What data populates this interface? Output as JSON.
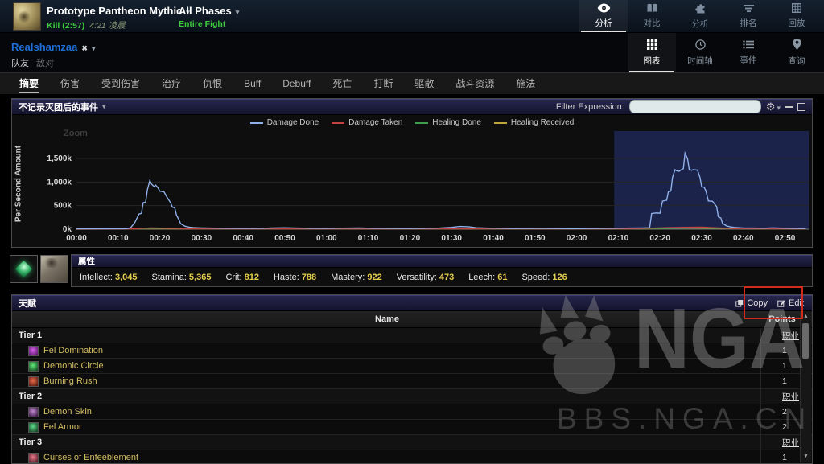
{
  "glyphs": {
    "caret": "▾",
    "close": "✖",
    "gear": "⚙",
    "scroll_up": "▲",
    "scroll_down": "▼"
  },
  "top_bar": {
    "boss_name": "Prototype Pantheon Mythic",
    "kill_text": "Kill (2:57)",
    "kill_time": "4:21 凌晨",
    "phase_name": "All Phases",
    "phase_detail": "Entire Fight",
    "view_tabs": [
      {
        "label": "分析",
        "icon": "eye-icon",
        "active": true
      },
      {
        "label": "对比",
        "icon": "compare-icon",
        "active": false
      },
      {
        "label": "分析",
        "icon": "puzzle-icon",
        "active": false
      },
      {
        "label": "排名",
        "icon": "rankings-icon",
        "active": false
      },
      {
        "label": "回放",
        "icon": "replay-icon",
        "active": false
      }
    ]
  },
  "player_bar": {
    "player_name": "Realshamzaa",
    "friendlies_label": "队友",
    "enemies_label": "敌对",
    "mode_tabs": [
      {
        "label": "图表",
        "icon": "grid-icon",
        "active": true
      },
      {
        "label": "时间轴",
        "icon": "clock-icon",
        "active": false
      },
      {
        "label": "事件",
        "icon": "list-icon",
        "active": false
      },
      {
        "label": "查询",
        "icon": "pin-icon",
        "active": false
      }
    ]
  },
  "tab_bar": [
    {
      "label": "摘要",
      "active": true
    },
    {
      "label": "伤害",
      "active": false
    },
    {
      "label": "受到伤害",
      "active": false
    },
    {
      "label": "治疗",
      "active": false
    },
    {
      "label": "仇恨",
      "active": false
    },
    {
      "label": "Buff",
      "active": false
    },
    {
      "label": "Debuff",
      "active": false
    },
    {
      "label": "死亡",
      "active": false
    },
    {
      "label": "打断",
      "active": false
    },
    {
      "label": "驱散",
      "active": false
    },
    {
      "label": "战斗资源",
      "active": false
    },
    {
      "label": "施法",
      "active": false
    }
  ],
  "chart_panel": {
    "title": "不记录灭团后的事件",
    "filter_label": "Filter Expression:",
    "filter_value": "",
    "zoom_label": "Zoom",
    "y_axis_label": "Per Second Amount"
  },
  "chart_data": {
    "type": "line",
    "title": "不记录灭团后的事件",
    "ylabel": "Per Second Amount",
    "ylim_k": [
      0,
      1750
    ],
    "grid": true,
    "legend_position": "top-center",
    "y_ticks": [
      {
        "label": "0k",
        "value": 0
      },
      {
        "label": "500k",
        "value": 500
      },
      {
        "label": "1,000k",
        "value": 1000
      },
      {
        "label": "1,500k",
        "value": 1500
      }
    ],
    "x_ticks": [
      "00:00",
      "00:10",
      "00:20",
      "00:30",
      "00:40",
      "00:50",
      "01:00",
      "01:10",
      "01:20",
      "01:30",
      "01:40",
      "01:50",
      "02:00",
      "02:10",
      "02:20",
      "02:30",
      "02:40",
      "02:50"
    ],
    "x_tick_interval_s": 10,
    "selection": {
      "start_t": 129,
      "end_t": 176,
      "color": "rgba(62,88,230,0.28)"
    },
    "series": [
      {
        "name": "Damage Done",
        "color": "#8fb0e8",
        "points": [
          [
            0,
            6
          ],
          [
            4,
            8
          ],
          [
            8,
            9
          ],
          [
            12,
            10
          ],
          [
            13,
            30
          ],
          [
            14,
            140
          ],
          [
            15,
            320
          ],
          [
            15.6,
            335
          ],
          [
            16,
            560
          ],
          [
            16.6,
            575
          ],
          [
            17,
            830
          ],
          [
            17.6,
            1035
          ],
          [
            18,
            960
          ],
          [
            18.6,
            905
          ],
          [
            19,
            935
          ],
          [
            19.6,
            872
          ],
          [
            20,
            806
          ],
          [
            21,
            792
          ],
          [
            21.6,
            698
          ],
          [
            22,
            640
          ],
          [
            22.6,
            558
          ],
          [
            23,
            470
          ],
          [
            23.6,
            452
          ],
          [
            24,
            298
          ],
          [
            24.6,
            200
          ],
          [
            25,
            118
          ],
          [
            26,
            64
          ],
          [
            27,
            44
          ],
          [
            28,
            36
          ],
          [
            30,
            27
          ],
          [
            33,
            22
          ],
          [
            36,
            19
          ],
          [
            40,
            17
          ],
          [
            44,
            15
          ],
          [
            47,
            26
          ],
          [
            50,
            30
          ],
          [
            53,
            24
          ],
          [
            56,
            18
          ],
          [
            60,
            15
          ],
          [
            64,
            22
          ],
          [
            68,
            26
          ],
          [
            71,
            19
          ],
          [
            75,
            15
          ],
          [
            79,
            13
          ],
          [
            83,
            17
          ],
          [
            87,
            24
          ],
          [
            90,
            40
          ],
          [
            92,
            58
          ],
          [
            94,
            52
          ],
          [
            96,
            30
          ],
          [
            99,
            22
          ],
          [
            103,
            16
          ],
          [
            107,
            13
          ],
          [
            111,
            15
          ],
          [
            115,
            13
          ],
          [
            119,
            11
          ],
          [
            123,
            13
          ],
          [
            127,
            15
          ],
          [
            130,
            20
          ],
          [
            133,
            24
          ],
          [
            136,
            28
          ],
          [
            137.5,
            30
          ],
          [
            138,
            330
          ],
          [
            139,
            345
          ],
          [
            140,
            340
          ],
          [
            140.6,
            595
          ],
          [
            141.6,
            615
          ],
          [
            142,
            798
          ],
          [
            142.6,
            808
          ],
          [
            143,
            1095
          ],
          [
            143.6,
            1262
          ],
          [
            144,
            1235
          ],
          [
            144.6,
            1228
          ],
          [
            145,
            1255
          ],
          [
            145.6,
            1282
          ],
          [
            146,
            1612
          ],
          [
            146.6,
            1495
          ],
          [
            147,
            1268
          ],
          [
            147.6,
            1248
          ],
          [
            148,
            1262
          ],
          [
            149,
            1252
          ],
          [
            149.6,
            1096
          ],
          [
            150,
            903
          ],
          [
            150.6,
            888
          ],
          [
            151,
            815
          ],
          [
            151.6,
            600
          ],
          [
            152.6,
            592
          ],
          [
            153.6,
            478
          ],
          [
            154,
            262
          ],
          [
            154.6,
            238
          ],
          [
            155,
            122
          ],
          [
            156,
            68
          ],
          [
            157,
            48
          ],
          [
            158,
            38
          ],
          [
            160,
            28
          ],
          [
            162,
            24
          ],
          [
            165,
            21
          ],
          [
            167,
            29
          ],
          [
            169,
            23
          ],
          [
            172,
            17
          ],
          [
            175,
            14
          ]
        ]
      },
      {
        "name": "Damage Taken",
        "color": "#c34343",
        "points": [
          [
            0,
            2
          ],
          [
            10,
            3
          ],
          [
            14,
            6
          ],
          [
            16,
            18
          ],
          [
            18,
            26
          ],
          [
            20,
            22
          ],
          [
            24,
            16
          ],
          [
            28,
            9
          ],
          [
            35,
            7
          ],
          [
            45,
            8
          ],
          [
            55,
            9
          ],
          [
            65,
            8
          ],
          [
            75,
            9
          ],
          [
            85,
            8
          ],
          [
            95,
            10
          ],
          [
            105,
            8
          ],
          [
            115,
            9
          ],
          [
            125,
            8
          ],
          [
            133,
            9
          ],
          [
            138,
            22
          ],
          [
            142,
            32
          ],
          [
            146,
            40
          ],
          [
            150,
            42
          ],
          [
            154,
            28
          ],
          [
            158,
            14
          ],
          [
            163,
            10
          ],
          [
            168,
            9
          ],
          [
            175,
            7
          ]
        ]
      },
      {
        "name": "Healing Done",
        "color": "#3f9e4c",
        "points": [
          [
            0,
            1
          ],
          [
            12,
            3
          ],
          [
            16,
            10
          ],
          [
            20,
            16
          ],
          [
            24,
            17
          ],
          [
            28,
            9
          ],
          [
            36,
            6
          ],
          [
            44,
            9
          ],
          [
            50,
            12
          ],
          [
            58,
            9
          ],
          [
            66,
            11
          ],
          [
            74,
            9
          ],
          [
            82,
            8
          ],
          [
            90,
            13
          ],
          [
            96,
            10
          ],
          [
            104,
            8
          ],
          [
            112,
            9
          ],
          [
            120,
            7
          ],
          [
            128,
            8
          ],
          [
            136,
            10
          ],
          [
            140,
            16
          ],
          [
            144,
            22
          ],
          [
            148,
            27
          ],
          [
            152,
            25
          ],
          [
            156,
            18
          ],
          [
            160,
            12
          ],
          [
            166,
            9
          ],
          [
            172,
            7
          ],
          [
            175,
            6
          ]
        ]
      },
      {
        "name": "Healing Received",
        "color": "#bfa63b",
        "points": [
          [
            0,
            3
          ],
          [
            8,
            5
          ],
          [
            14,
            8
          ],
          [
            20,
            11
          ],
          [
            26,
            8
          ],
          [
            34,
            6
          ],
          [
            42,
            7
          ],
          [
            50,
            8
          ],
          [
            58,
            6
          ],
          [
            66,
            7
          ],
          [
            74,
            8
          ],
          [
            82,
            6
          ],
          [
            90,
            9
          ],
          [
            98,
            7
          ],
          [
            106,
            6
          ],
          [
            114,
            7
          ],
          [
            122,
            6
          ],
          [
            130,
            7
          ],
          [
            136,
            9
          ],
          [
            141,
            18
          ],
          [
            146,
            24
          ],
          [
            150,
            23
          ],
          [
            155,
            16
          ],
          [
            160,
            10
          ],
          [
            166,
            7
          ],
          [
            175,
            5
          ]
        ]
      }
    ]
  },
  "stats_panel": {
    "title": "属性",
    "stats": [
      {
        "label": "Intellect",
        "value": "3,045"
      },
      {
        "label": "Stamina",
        "value": "5,365"
      },
      {
        "label": "Crit",
        "value": "812"
      },
      {
        "label": "Haste",
        "value": "788"
      },
      {
        "label": "Mastery",
        "value": "922"
      },
      {
        "label": "Versatility",
        "value": "473"
      },
      {
        "label": "Leech",
        "value": "61"
      },
      {
        "label": "Speed",
        "value": "126"
      }
    ]
  },
  "talents_panel": {
    "title": "天赋",
    "copy_label": "Copy",
    "edit_label": "Edit",
    "name_header": "Name",
    "points_header": "Points",
    "rows": [
      {
        "type": "tier",
        "name": "Tier 1",
        "points": "职业"
      },
      {
        "type": "spell",
        "name": "Fel Domination",
        "points": "1",
        "icon_colors": [
          "#d65fe8",
          "#4a0d5c"
        ]
      },
      {
        "type": "spell",
        "name": "Demonic Circle",
        "points": "1",
        "icon_colors": [
          "#63e87a",
          "#0a3a14"
        ]
      },
      {
        "type": "spell",
        "name": "Burning Rush",
        "points": "1",
        "icon_colors": [
          "#e86a4a",
          "#4a0f08"
        ]
      },
      {
        "type": "tier",
        "name": "Tier 2",
        "points": "职业"
      },
      {
        "type": "spell",
        "name": "Demon Skin",
        "points": "2",
        "icon_colors": [
          "#c08ad0",
          "#2d0b36"
        ]
      },
      {
        "type": "spell",
        "name": "Fel Armor",
        "points": "2",
        "icon_colors": [
          "#5ed98a",
          "#0b3318"
        ]
      },
      {
        "type": "tier",
        "name": "Tier 3",
        "points": "职业"
      },
      {
        "type": "spell",
        "name": "Curses of Enfeeblement",
        "points": "1",
        "icon_colors": [
          "#e87a8a",
          "#47101d"
        ]
      }
    ]
  },
  "watermark": {
    "logo_text": "NGA",
    "site_text": "BBS.NGA.CN"
  },
  "annotation": {
    "highlighted_control": "Copy",
    "box_color": "#d22b1c"
  }
}
